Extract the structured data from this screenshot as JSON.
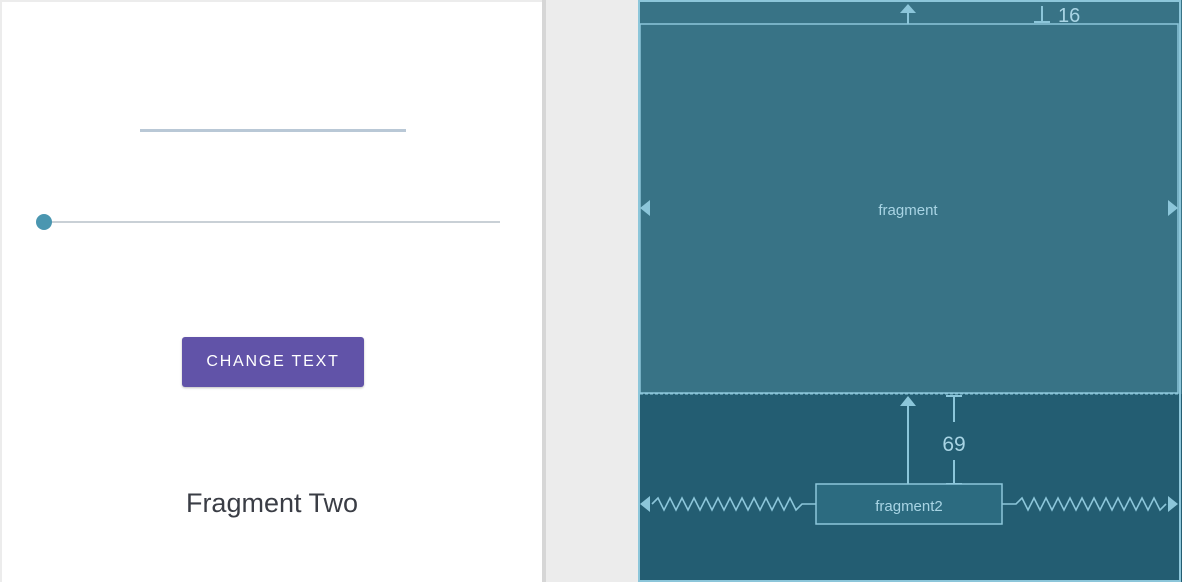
{
  "design": {
    "button_label": "CHANGE TEXT",
    "fragment_text": "Fragment Two",
    "seekbar": {
      "progress": 0
    }
  },
  "blueprint": {
    "top_fragment_label": "fragment",
    "bottom_fragment_label": "fragment2",
    "top_margin_value": "16",
    "gap_margin_value": "69"
  },
  "colors": {
    "button": "#6153a8",
    "blueprint_top": "#387386",
    "blueprint_bottom": "#235d72",
    "blueprint_lines": "#8cc6da"
  }
}
